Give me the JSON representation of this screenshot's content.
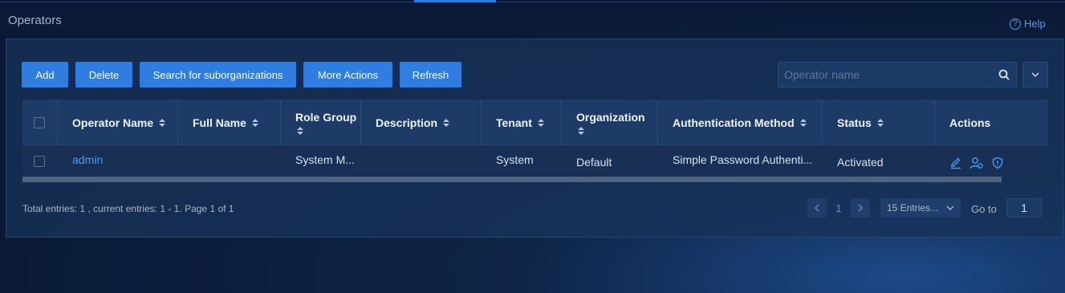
{
  "page": {
    "title": "Operators",
    "help_label": "Help",
    "help_icon": "help-circle-icon"
  },
  "toolbar": {
    "add_label": "Add",
    "delete_label": "Delete",
    "search_suborg_label": "Search for suborganizations",
    "more_actions_label": "More Actions",
    "refresh_label": "Refresh",
    "search_placeholder": "Operator name",
    "search_value": ""
  },
  "table": {
    "columns": [
      {
        "key": "operator_name",
        "label": "Operator Name"
      },
      {
        "key": "full_name",
        "label": "Full Name"
      },
      {
        "key": "role_group",
        "label": "Role Group"
      },
      {
        "key": "description",
        "label": "Description"
      },
      {
        "key": "tenant",
        "label": "Tenant"
      },
      {
        "key": "organization",
        "label": "Organization"
      },
      {
        "key": "auth_method",
        "label": "Authentication Method"
      },
      {
        "key": "status",
        "label": "Status"
      },
      {
        "key": "actions",
        "label": "Actions"
      }
    ],
    "rows": [
      {
        "operator_name": "admin",
        "full_name": "",
        "role_group": "System M...",
        "description": "",
        "tenant": "System",
        "organization": "Default",
        "auth_method": "Simple Password Authenti...",
        "status": "Activated",
        "action_icons": [
          "edit-icon",
          "user-settings-icon",
          "shield-icon"
        ]
      }
    ]
  },
  "pagination": {
    "summary": "Total entries: 1 , current entries: 1 - 1. Page 1 of 1",
    "current_page": "1",
    "page_size_label": "15 Entries...",
    "goto_label": "Go to",
    "goto_value": "1"
  },
  "colors": {
    "accent": "#2f7de1",
    "link": "#4b9cf5",
    "background": "#0a1a36",
    "panel": "#183258"
  }
}
